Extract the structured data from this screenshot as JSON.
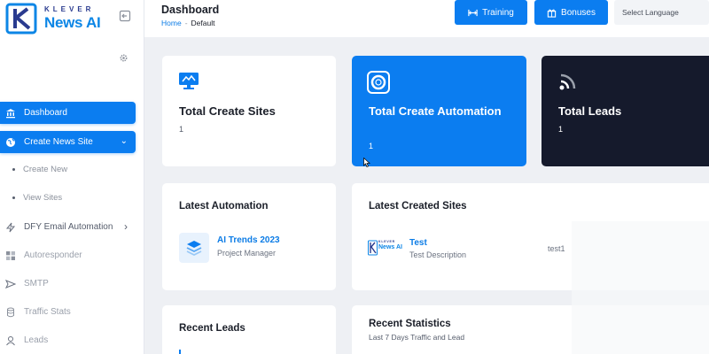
{
  "logo": {
    "top": "KLEVER",
    "bottom": "News AI"
  },
  "sidebar": {
    "items": [
      {
        "label": "Dashboard",
        "icon": "bank-icon"
      },
      {
        "label": "Create News Site",
        "icon": "globe-icon"
      },
      {
        "label": "DFY Email Automation",
        "icon": "bolt-icon"
      },
      {
        "label": "Autoresponder",
        "icon": "grid-icon"
      },
      {
        "label": "SMTP",
        "icon": "send-icon"
      },
      {
        "label": "Traffic Stats",
        "icon": "database-icon"
      },
      {
        "label": "Leads",
        "icon": "leads-icon"
      }
    ],
    "subitems": [
      "Create New",
      "View Sites"
    ]
  },
  "header": {
    "title": "Dashboard",
    "breadcrumb": {
      "home": "Home",
      "separator": "-",
      "current": "Default"
    },
    "training_label": "Training",
    "bonuses_label": "Bonuses",
    "language_label": "Select Language"
  },
  "stats": [
    {
      "title": "Total Create Sites",
      "value": "1"
    },
    {
      "title": "Total Create Automation",
      "value": "1"
    },
    {
      "title": "Total Leads",
      "value": "1"
    }
  ],
  "latest_automation": {
    "title": "Latest Automation",
    "item": {
      "name": "AI Trends 2023",
      "role": "Project Manager"
    }
  },
  "latest_sites": {
    "title": "Latest Created Sites",
    "item": {
      "logo_top": "KLEVER",
      "logo_bottom": "News AI",
      "name": "Test",
      "description": "Test Description",
      "slug": "test1"
    }
  },
  "recent_leads": {
    "title": "Recent Leads"
  },
  "recent_statistics": {
    "title": "Recent Statistics",
    "subtitle": "Last 7 Days Traffic and Lead"
  },
  "colors": {
    "primary": "#0b7df0",
    "dark_card": "#151a2c",
    "background": "#eef0f4"
  }
}
